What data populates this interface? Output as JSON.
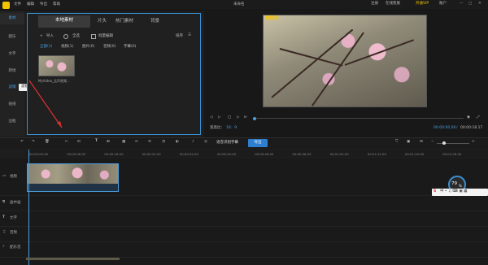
{
  "titlebar": {
    "menus": [
      "文件",
      "编辑",
      "导出",
      "帮助"
    ],
    "title": "未命名",
    "register": "注册",
    "online_service": "在线客服",
    "vip": "开通VIP",
    "account": "账户",
    "autosave": "上次保存于 15:47"
  },
  "rail": {
    "items": [
      "素材",
      "配乐",
      "文字",
      "转场",
      "滤镜",
      "贴纸",
      "边框"
    ],
    "tooltip": "滤镜"
  },
  "media": {
    "tabs": [
      "本地素材",
      "片头",
      "热门素材",
      "背景"
    ],
    "import": "导入",
    "select_all": "全选",
    "batch_edit": "批量编辑",
    "sort": "排序",
    "filters": [
      "全部(1)",
      "视频(1)",
      "图片(0)",
      "音频(0)",
      "字幕(0)"
    ],
    "file_name": "MyVideo_无声视频..."
  },
  "preview": {
    "watermark": "爱剪辑",
    "aspect_label": "宽高比：",
    "aspect_value": "16：9",
    "time_current": "00:00:00.00",
    "time_total": "00:00:18.17"
  },
  "timeline": {
    "toolbar": {
      "recognize_subtitle": "语音识别字幕",
      "export": "导出"
    },
    "ruler_ticks": [
      "00:00:00.00",
      "00:00:08.00",
      "00:00:16.00",
      "00:00:24.00",
      "00:00:32.00",
      "00:00:40.00",
      "00:00:48.00",
      "00:00:56.00",
      "00:01:04.00",
      "00:01:12.00",
      "00:01:20.00",
      "00:01:28.00"
    ],
    "tracks": [
      "视频",
      "画中画",
      "文字",
      "音频",
      "配乐音"
    ],
    "performance": "79",
    "performance_unit": "%"
  },
  "colors": {
    "accent": "#4aa0e0",
    "brand": "#f5c400",
    "export_btn": "#2f7fd1"
  }
}
